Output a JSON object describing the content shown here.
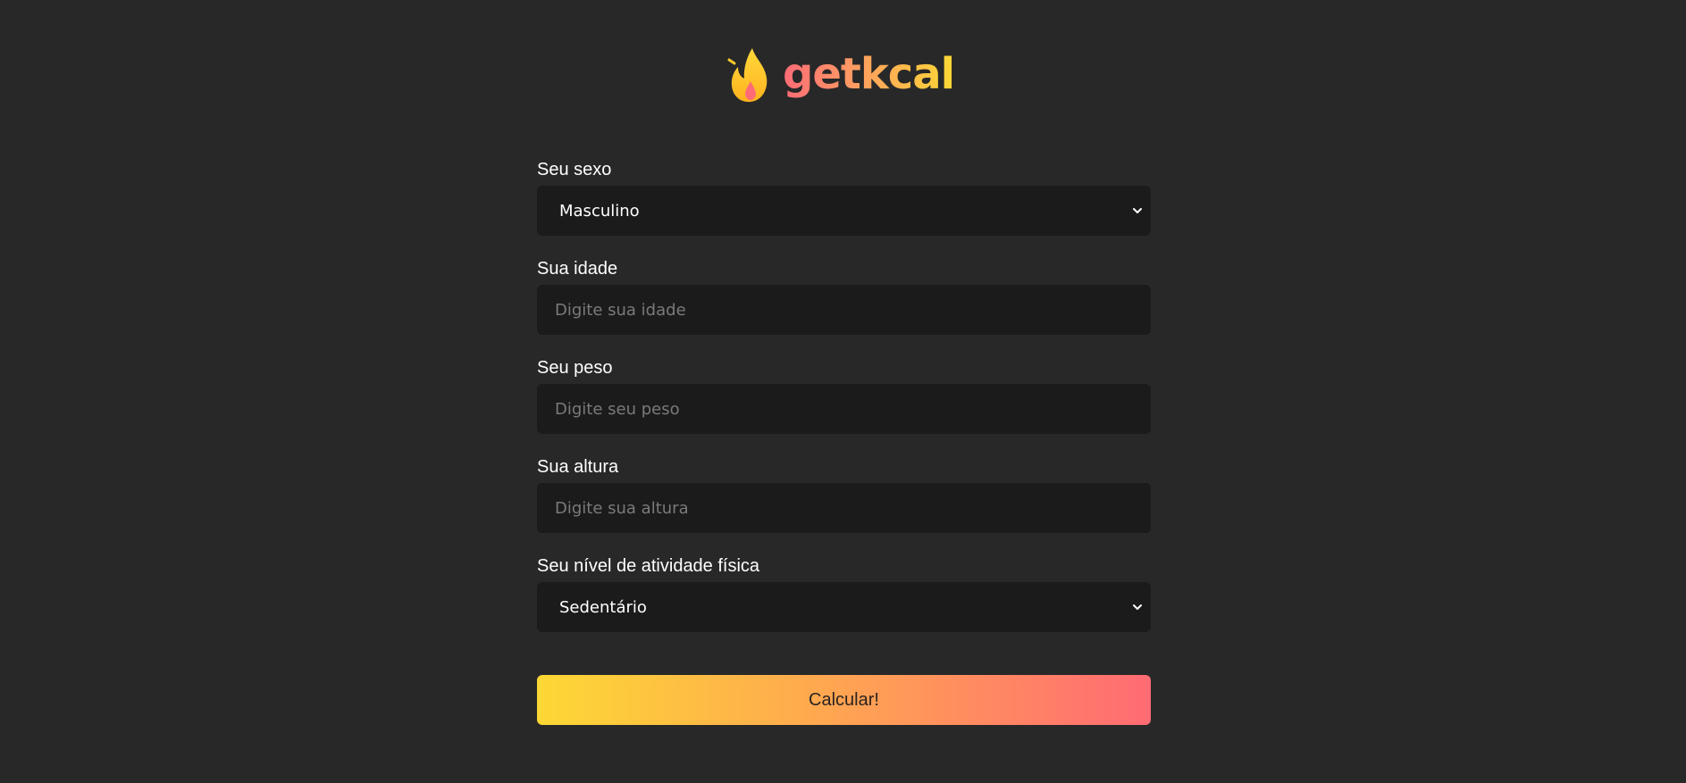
{
  "brand": {
    "name": "getkcal",
    "icon": "flame-icon",
    "gradient_start": "#fe6b76",
    "gradient_end": "#fdd835"
  },
  "form": {
    "sex": {
      "label": "Seu sexo",
      "value": "Masculino"
    },
    "age": {
      "label": "Sua idade",
      "placeholder": "Digite sua idade"
    },
    "weight": {
      "label": "Seu peso",
      "placeholder": "Digite seu peso"
    },
    "height": {
      "label": "Sua altura",
      "placeholder": "Digite sua altura"
    },
    "activity": {
      "label": "Seu nível de atividade física",
      "value": "Sedentário"
    },
    "submit_label": "Calcular!"
  },
  "colors": {
    "background": "#282828",
    "field_background": "#1b1b1b",
    "button_gradient_start": "#fdd835",
    "button_gradient_end": "#ff6b73"
  }
}
